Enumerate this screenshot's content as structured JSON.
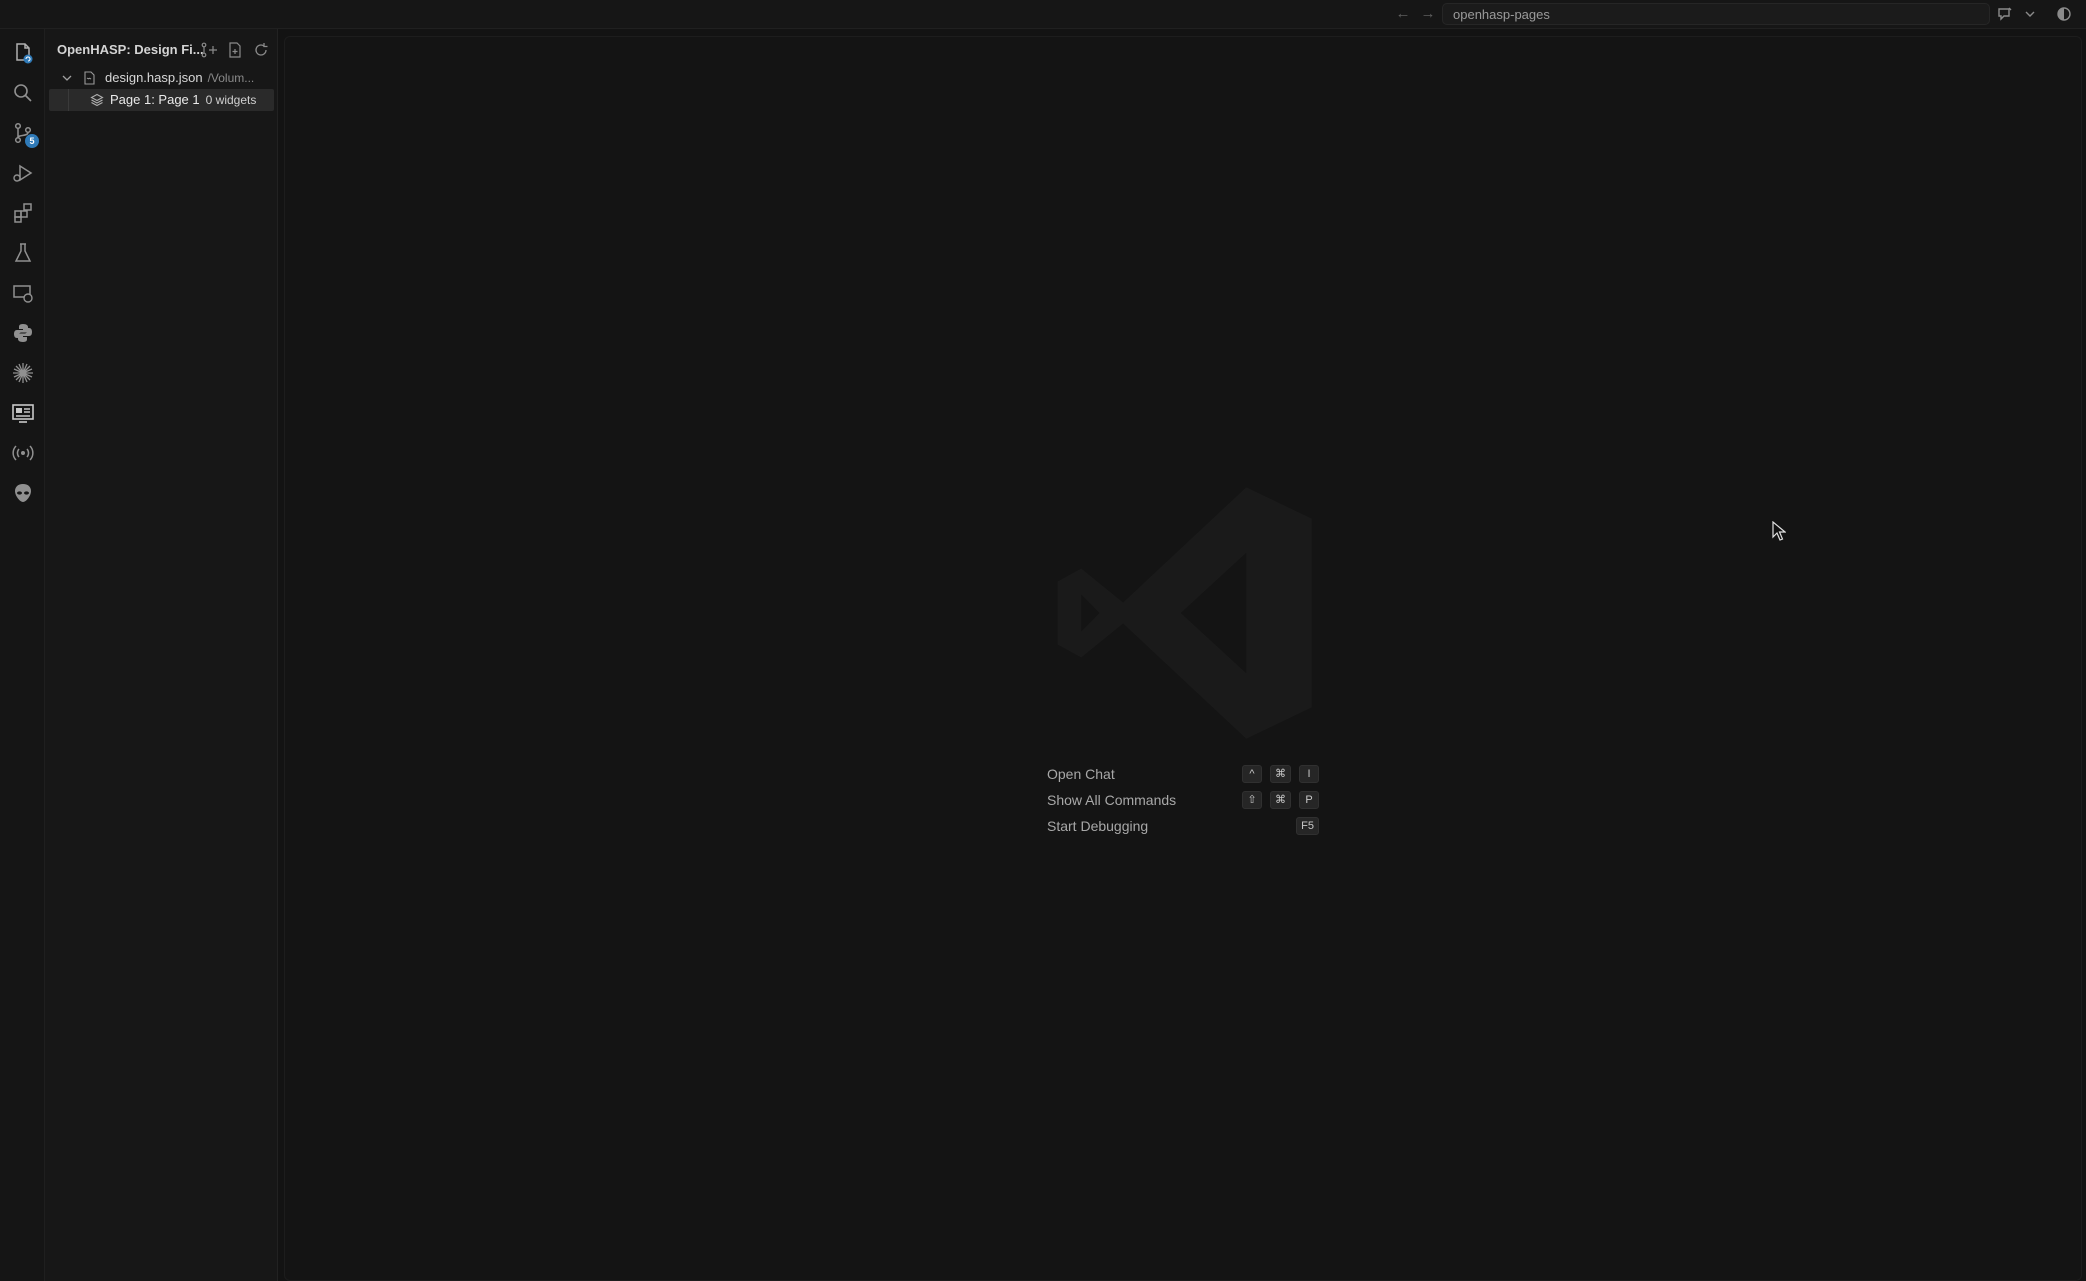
{
  "titlebar": {
    "search_text": "openhasp-pages",
    "back_icon": "arrow-left-icon",
    "forward_icon": "arrow-right-icon"
  },
  "activity_bar": {
    "items": [
      {
        "name": "explorer",
        "icon": "files-icon",
        "badge": ""
      },
      {
        "name": "search",
        "icon": "search-icon",
        "badge": ""
      },
      {
        "name": "source-control",
        "icon": "source-control-icon",
        "badge": "5"
      },
      {
        "name": "run-debug",
        "icon": "run-debug-icon",
        "badge": ""
      },
      {
        "name": "extensions",
        "icon": "extensions-icon",
        "badge": ""
      },
      {
        "name": "testing",
        "icon": "flask-icon",
        "badge": ""
      },
      {
        "name": "remote-explorer",
        "icon": "remote-explorer-icon",
        "badge": ""
      },
      {
        "name": "python",
        "icon": "python-icon",
        "badge": ""
      },
      {
        "name": "claude",
        "icon": "sparkle-icon",
        "badge": ""
      },
      {
        "name": "openhasp-designer",
        "icon": "display-icon",
        "badge": ""
      },
      {
        "name": "broadcast",
        "icon": "broadcast-icon",
        "badge": ""
      },
      {
        "name": "alien",
        "icon": "alien-icon",
        "badge": ""
      }
    ]
  },
  "sidebar": {
    "title": "OpenHASP: Design Fi...",
    "tree": [
      {
        "file": "design.hasp.json",
        "path": "/Volum..."
      },
      {
        "label": "Page 1: Page 1",
        "description": "0 widgets"
      }
    ]
  },
  "editor": {
    "shortcuts": [
      {
        "label": "Open Chat",
        "keys": [
          "^",
          "⌘",
          "I"
        ]
      },
      {
        "label": "Show All Commands",
        "keys": [
          "⇧",
          "⌘",
          "P"
        ]
      },
      {
        "label": "Start Debugging",
        "keys": [
          "F5"
        ]
      }
    ]
  },
  "colors": {
    "background": "#131313",
    "sidebar": "#171717",
    "badge": "#2f7ab8"
  }
}
